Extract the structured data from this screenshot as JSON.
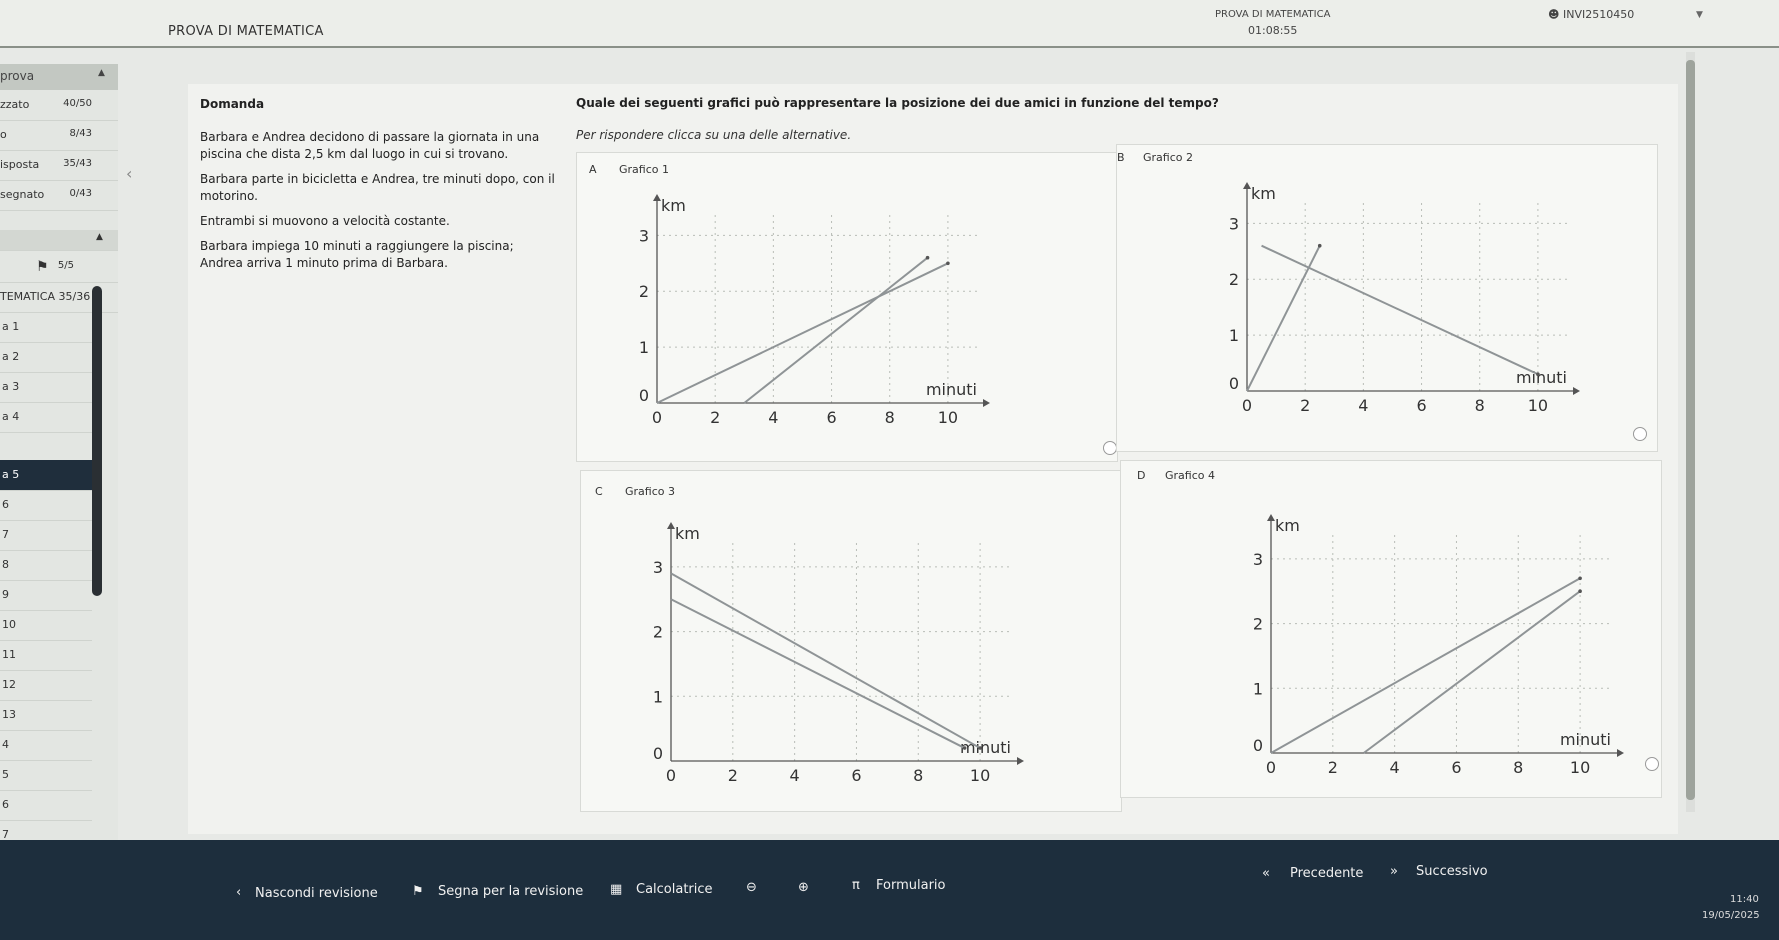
{
  "header": {
    "app_title": "PROVA DI MATEMATICA",
    "exam_title": "PROVA DI MATEMATICA",
    "timer": "01:08:55",
    "user": "INVI2510450"
  },
  "sidebar": {
    "section": "prova",
    "stats": [
      {
        "label": "zzato",
        "value": "40/50"
      },
      {
        "label": "o",
        "value": "8/43"
      },
      {
        "label": "isposta",
        "value": "35/43"
      },
      {
        "label": "segnato",
        "value": "0/43"
      }
    ],
    "count": "5/5",
    "subject": "TEMATICA 35/36",
    "questions": [
      "a 1",
      "a 2",
      "a 3",
      "a 4",
      "a 5",
      "6",
      "7",
      "8",
      "9",
      "10",
      "11",
      "12",
      "13",
      "4",
      "5",
      "6",
      "7",
      "8"
    ]
  },
  "question": {
    "heading": "Domanda",
    "paragraphs": [
      "Barbara e Andrea decidono di passare la giornata in una piscina che dista 2,5 km dal luogo in cui si trovano.",
      "Barbara parte in bicicletta e Andrea, tre minuti dopo, con il motorino.",
      "Entrambi si muovono a velocità costante.",
      "Barbara impiega 10 minuti a raggiungere la piscina; Andrea arriva 1 minuto prima di Barbara."
    ],
    "prompt": "Quale dei seguenti grafici può rappresentare la posizione dei due amici in funzione del tempo?",
    "instruction": "Per rispondere clicca su una delle alternative."
  },
  "options": [
    {
      "letter": "A",
      "title": "Grafico 1"
    },
    {
      "letter": "B",
      "title": "Grafico 2"
    },
    {
      "letter": "C",
      "title": "Grafico 3"
    },
    {
      "letter": "D",
      "title": "Grafico 4"
    }
  ],
  "chart_data": [
    {
      "type": "line",
      "title": "Grafico 1",
      "xlabel": "minuti",
      "ylabel": "km",
      "xticks": [
        "0",
        "2",
        "4",
        "6",
        "8",
        "10"
      ],
      "yticks": [
        "0",
        "1",
        "2",
        "3"
      ],
      "xlim": [
        0,
        11
      ],
      "ylim": [
        0,
        3.4
      ],
      "series": [
        {
          "x": [
            0,
            10
          ],
          "y": [
            0,
            2.5
          ]
        },
        {
          "x": [
            3,
            9.3
          ],
          "y": [
            0,
            2.6
          ]
        }
      ]
    },
    {
      "type": "line",
      "title": "Grafico 2",
      "xlabel": "minuti",
      "ylabel": "km",
      "xticks": [
        "0",
        "2",
        "4",
        "6",
        "8",
        "10"
      ],
      "yticks": [
        "0",
        "1",
        "2",
        "3"
      ],
      "xlim": [
        0,
        11
      ],
      "ylim": [
        0,
        3.4
      ],
      "series": [
        {
          "x": [
            0,
            2.5
          ],
          "y": [
            0,
            2.6
          ]
        },
        {
          "x": [
            0.5,
            10
          ],
          "y": [
            2.6,
            0.3
          ]
        }
      ]
    },
    {
      "type": "line",
      "title": "Grafico 3",
      "xlabel": "minuti",
      "ylabel": "km",
      "xticks": [
        "0",
        "2",
        "4",
        "6",
        "8",
        "10"
      ],
      "yticks": [
        "0",
        "1",
        "2",
        "3"
      ],
      "xlim": [
        0,
        11
      ],
      "ylim": [
        0,
        3.4
      ],
      "series": [
        {
          "x": [
            0,
            10
          ],
          "y": [
            2.9,
            0.2
          ]
        },
        {
          "x": [
            0,
            9.5
          ],
          "y": [
            2.5,
            0.2
          ]
        }
      ]
    },
    {
      "type": "line",
      "title": "Grafico 4",
      "xlabel": "minuti",
      "ylabel": "km",
      "xticks": [
        "0",
        "2",
        "4",
        "6",
        "8",
        "10"
      ],
      "yticks": [
        "0",
        "1",
        "2",
        "3"
      ],
      "xlim": [
        0,
        11
      ],
      "ylim": [
        0,
        3.4
      ],
      "series": [
        {
          "x": [
            0,
            10
          ],
          "y": [
            0,
            2.7
          ]
        },
        {
          "x": [
            3,
            10
          ],
          "y": [
            0,
            2.5
          ]
        }
      ]
    }
  ],
  "footer": {
    "hide_review": "Nascondi revisione",
    "mark_review": "Segna per la revisione",
    "calculator": "Calcolatrice",
    "formulary": "Formulario",
    "previous": "Precedente",
    "next": "Successivo",
    "clock": "11:40",
    "date": "19/05/2025"
  }
}
